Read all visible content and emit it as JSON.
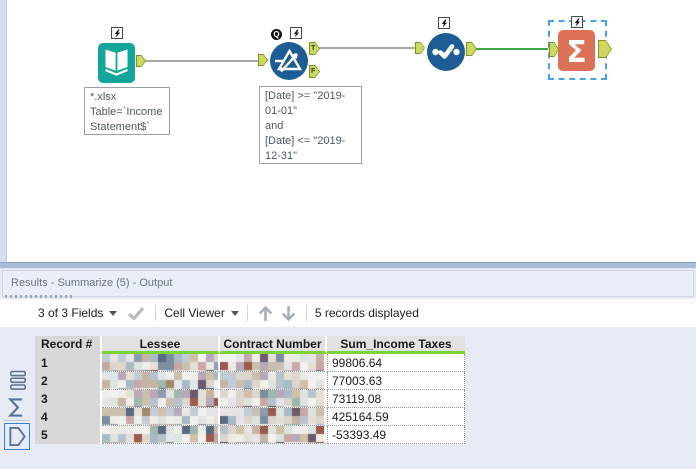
{
  "canvas": {
    "badge_q": "Q",
    "anchor_true_label": "T",
    "anchor_false_label": "F",
    "icons": {
      "input_tool_icon": "open-book",
      "filter_tool_icon": "funnel-triangle",
      "select_tool_icon": "dot-check-dot",
      "summarize_tool_icon": "sigma",
      "badge_icon": "lightning-bolt"
    },
    "input_annotation": "*.xlsx\nTable=`Income\nStatement$`",
    "filter_annotation": "[Date] >= \"2019-\n01-01\"\nand\n[Date] <= \"2019-\n12-31\""
  },
  "results": {
    "title": "Results - Summarize (5) - Output",
    "toolbar": {
      "fields": "3 of 3 Fields",
      "cell_viewer": "Cell Viewer",
      "records": "5 records displayed"
    },
    "table": {
      "columns": [
        "Record #",
        "Lessee",
        "Contract Number",
        "Sum_Income Taxes"
      ],
      "rows": [
        {
          "record": "1",
          "lessee_redacted": true,
          "contract_redacted": true,
          "sum": "99806.64"
        },
        {
          "record": "2",
          "lessee_redacted": true,
          "contract_redacted": true,
          "sum": "77003.63"
        },
        {
          "record": "3",
          "lessee_redacted": true,
          "contract_redacted": true,
          "sum": "73119.08"
        },
        {
          "record": "4",
          "lessee_redacted": true,
          "contract_redacted": true,
          "sum": "425164.59"
        },
        {
          "record": "5",
          "lessee_redacted": true,
          "contract_redacted": true,
          "sum": "-53393.49"
        }
      ]
    }
  },
  "colors": {
    "tool_teal": "#13a49a",
    "tool_blue": "#1e5c96",
    "tool_salmon": "#dc7158",
    "anchor_green": "#cdd95e",
    "wire_green": "#3da84b",
    "selection_blue": "#4aa0ee",
    "quality_bar_green": "#7ad339",
    "panel_bg": "#e7ebf6"
  }
}
